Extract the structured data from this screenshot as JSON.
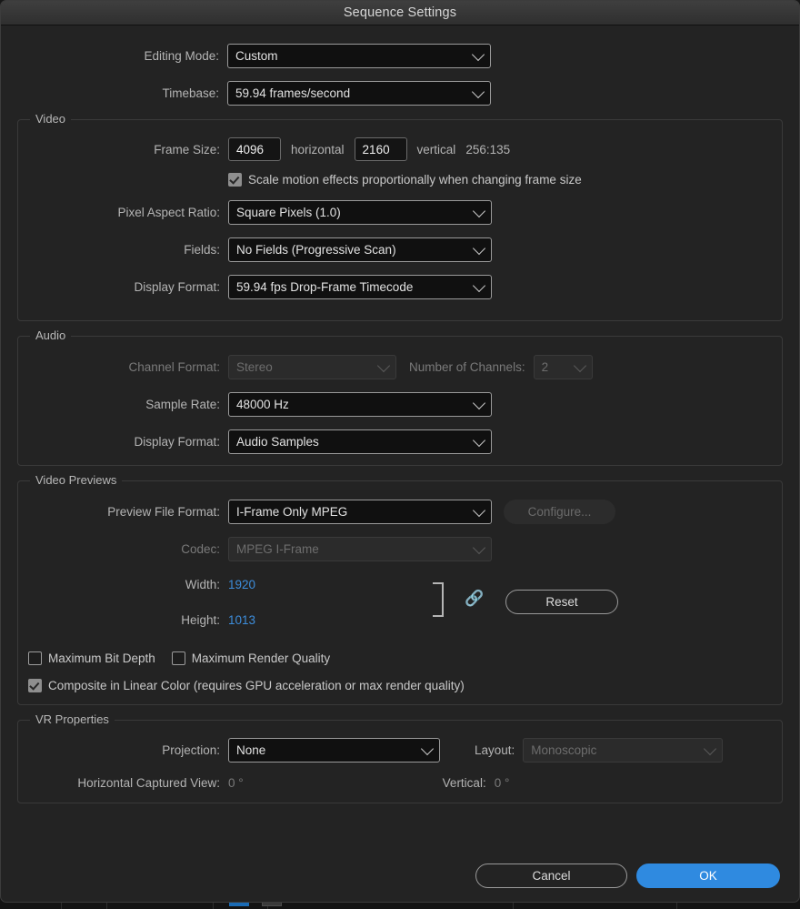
{
  "window": {
    "title": "Sequence Settings"
  },
  "top": {
    "editing_mode_label": "Editing Mode:",
    "editing_mode_value": "Custom",
    "timebase_label": "Timebase:",
    "timebase_value": "59.94  frames/second"
  },
  "video": {
    "legend": "Video",
    "frame_size_label": "Frame Size:",
    "frame_width_value": "4096",
    "horizontal_label": "horizontal",
    "frame_height_value": "2160",
    "vertical_label": "vertical",
    "aspect_ratio_text": "256:135",
    "scale_motion_label": "Scale motion effects proportionally when changing frame size",
    "scale_motion_checked": true,
    "pixel_aspect_label": "Pixel Aspect Ratio:",
    "pixel_aspect_value": "Square Pixels (1.0)",
    "fields_label": "Fields:",
    "fields_value": "No Fields (Progressive Scan)",
    "display_format_label": "Display Format:",
    "display_format_value": "59.94 fps Drop-Frame Timecode"
  },
  "audio": {
    "legend": "Audio",
    "channel_format_label": "Channel Format:",
    "channel_format_value": "Stereo",
    "number_of_channels_label": "Number of Channels:",
    "number_of_channels_value": "2",
    "sample_rate_label": "Sample Rate:",
    "sample_rate_value": "48000 Hz",
    "display_format_label": "Display Format:",
    "display_format_value": "Audio Samples"
  },
  "video_previews": {
    "legend": "Video Previews",
    "preview_file_format_label": "Preview File Format:",
    "preview_file_format_value": "I-Frame Only MPEG",
    "configure_label": "Configure...",
    "codec_label": "Codec:",
    "codec_value": "MPEG I-Frame",
    "width_label": "Width:",
    "width_value": "1920",
    "height_label": "Height:",
    "height_value": "1013",
    "reset_label": "Reset",
    "max_bit_depth_label": "Maximum Bit Depth",
    "max_bit_depth_checked": false,
    "max_render_quality_label": "Maximum Render Quality",
    "max_render_quality_checked": false,
    "composite_linear_label": "Composite in Linear Color (requires GPU acceleration or max render quality)",
    "composite_linear_checked": true
  },
  "vr": {
    "legend": "VR Properties",
    "projection_label": "Projection:",
    "projection_value": "None",
    "layout_label": "Layout:",
    "layout_value": "Monoscopic",
    "horizontal_captured_label": "Horizontal Captured View:",
    "horizontal_captured_value": "0 °",
    "vertical_label": "Vertical:",
    "vertical_value": "0 °"
  },
  "footer": {
    "cancel_label": "Cancel",
    "ok_label": "OK"
  },
  "colors": {
    "accent": "#2f8ae0",
    "value_blue": "#3d8ddb",
    "dialog_bg": "#232323",
    "titlebar": "#3a3a3a"
  }
}
